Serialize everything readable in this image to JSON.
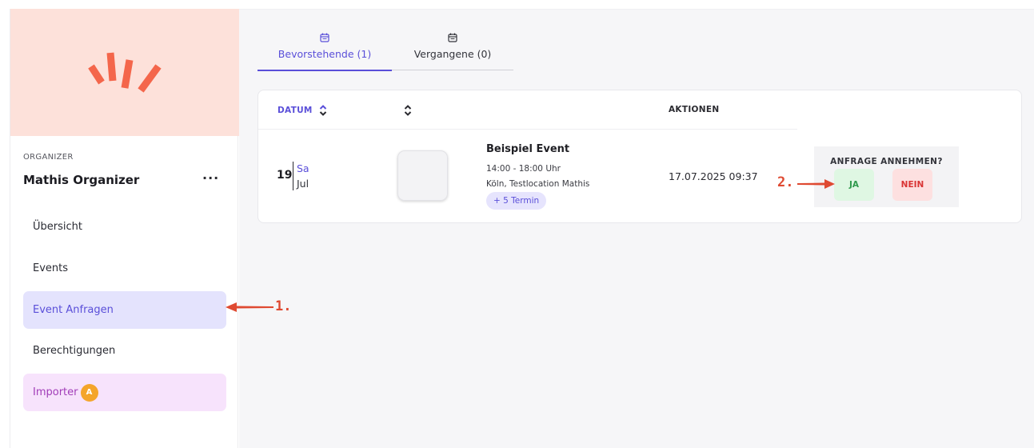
{
  "sidebar": {
    "logo_icon": "burst-logo-icon",
    "org_label": "ORGANIZER",
    "org_name": "Mathis Organizer",
    "more_label": "···",
    "items": [
      {
        "label": "Übersicht",
        "state": "default"
      },
      {
        "label": "Events",
        "state": "default"
      },
      {
        "label": "Event Anfragen",
        "state": "active"
      },
      {
        "label": "Berechtigungen",
        "state": "default"
      },
      {
        "label": "Importer",
        "state": "highlight",
        "badge": "A"
      }
    ]
  },
  "tabs": [
    {
      "label": "Bevorstehende (1)",
      "icon": "calendar-icon",
      "active": true
    },
    {
      "label": "Vergangene (0)",
      "icon": "calendar-icon",
      "active": false
    }
  ],
  "table": {
    "headers": {
      "datum": "DATUM",
      "event": "",
      "aktionen": "AKTIONEN"
    },
    "row": {
      "day": "19",
      "weekday": "Sa",
      "month": "Jul",
      "title": "Beispiel Event",
      "time": "14:00 - 18:00 Uhr",
      "location": "Köln, Testlocation Mathis",
      "more_dates": "+ 5 Termin",
      "request_date": "17.07.2025 09:37",
      "request_label": "ANFRAGE ANNEHMEN?",
      "yes_label": "JA",
      "no_label": "NEIN"
    }
  },
  "annotations": {
    "one": "1.",
    "two": "2."
  },
  "colors": {
    "accent": "#5a4fd9",
    "annotation": "#df4a32",
    "hero": "#fde1da",
    "logo": "#f4664b"
  }
}
